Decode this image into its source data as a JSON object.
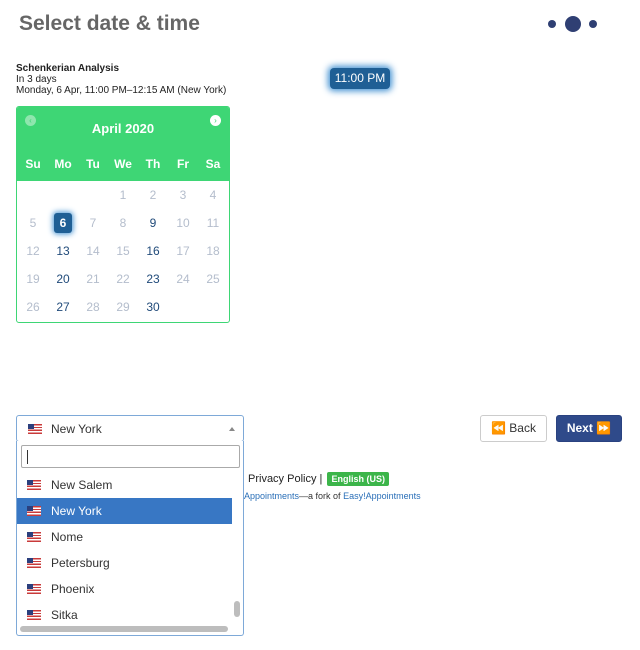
{
  "page": {
    "title": "Select date & time"
  },
  "appointment": {
    "service": "Schenkerian Analysis",
    "relative": "In 3 days",
    "datetime": "Monday, 6 Apr, 11:00 PM–12:15 AM (New York)"
  },
  "time_slot": {
    "label": "11:00 PM",
    "selected": true
  },
  "calendar": {
    "month_label": "April 2020",
    "prev_icon": "‹",
    "next_icon": "›",
    "weekdays": [
      "Su",
      "Mo",
      "Tu",
      "We",
      "Th",
      "Fr",
      "Sa"
    ],
    "weeks": [
      [
        {
          "d": ""
        },
        {
          "d": ""
        },
        {
          "d": ""
        },
        {
          "d": "1"
        },
        {
          "d": "2"
        },
        {
          "d": "3"
        },
        {
          "d": "4"
        }
      ],
      [
        {
          "d": "5"
        },
        {
          "d": "6",
          "selected": true
        },
        {
          "d": "7"
        },
        {
          "d": "8"
        },
        {
          "d": "9",
          "available": true
        },
        {
          "d": "10"
        },
        {
          "d": "11"
        }
      ],
      [
        {
          "d": "12"
        },
        {
          "d": "13",
          "available": true
        },
        {
          "d": "14"
        },
        {
          "d": "15"
        },
        {
          "d": "16",
          "available": true
        },
        {
          "d": "17"
        },
        {
          "d": "18"
        }
      ],
      [
        {
          "d": "19"
        },
        {
          "d": "20",
          "available": true
        },
        {
          "d": "21"
        },
        {
          "d": "22"
        },
        {
          "d": "23",
          "available": true
        },
        {
          "d": "24"
        },
        {
          "d": "25"
        }
      ],
      [
        {
          "d": "26"
        },
        {
          "d": "27",
          "available": true
        },
        {
          "d": "28"
        },
        {
          "d": "29"
        },
        {
          "d": "30",
          "available": true
        },
        {
          "d": ""
        },
        {
          "d": ""
        }
      ]
    ]
  },
  "timezone": {
    "selected": "New York",
    "search_value": "",
    "options": [
      {
        "label": "New Salem",
        "active": false
      },
      {
        "label": "New York",
        "active": true
      },
      {
        "label": "Nome",
        "active": false
      },
      {
        "label": "Petersburg",
        "active": false
      },
      {
        "label": "Phoenix",
        "active": false
      },
      {
        "label": "Sitka",
        "active": false
      }
    ]
  },
  "buttons": {
    "back": "⏪ Back",
    "next": "Next ⏩"
  },
  "footer": {
    "privacy": "Privacy Policy",
    "separator": "|",
    "language": "English (US)",
    "credit_link": "Appointments",
    "credit_text": "—a fork of ",
    "credit_link2": "Easy!Appointments"
  },
  "colors": {
    "calendar_green": "#3ed675",
    "selected_blue": "#1f5f95",
    "next_button": "#2f4a8a",
    "dropdown_highlight": "#3877c4",
    "language_badge": "#3cb54a"
  }
}
